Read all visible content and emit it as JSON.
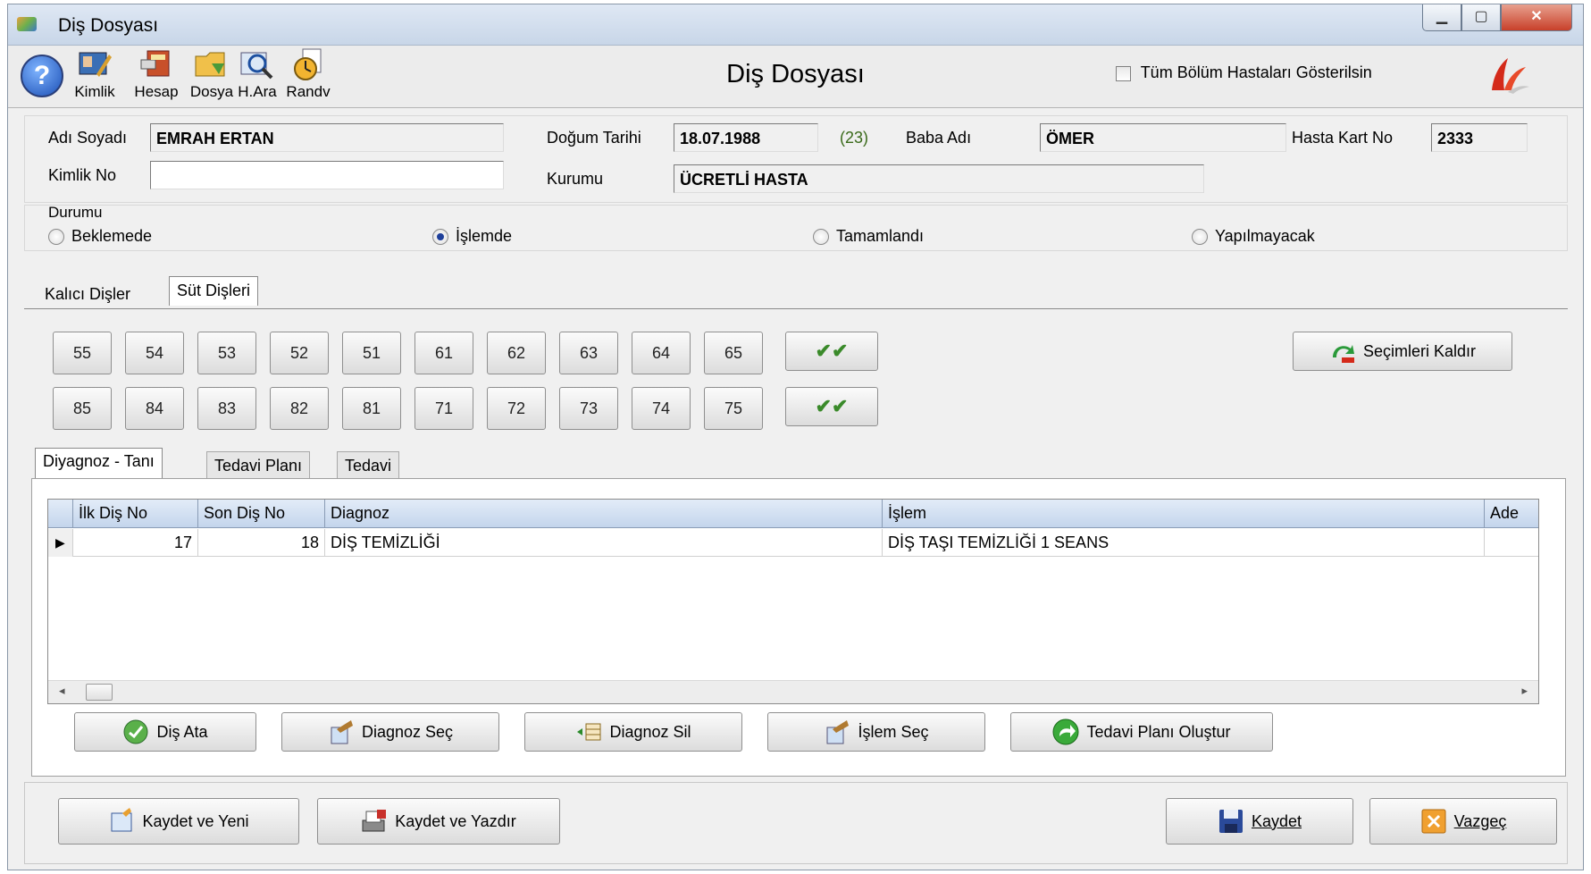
{
  "window": {
    "title": "Diş Dosyası"
  },
  "toolbar": {
    "items": [
      {
        "label": "Kimlik",
        "icon": "id-card-icon"
      },
      {
        "label": "Hesap",
        "icon": "calculator-icon"
      },
      {
        "label": "Dosya",
        "icon": "folder-icon"
      },
      {
        "label": "H.Ara",
        "icon": "search-icon"
      },
      {
        "label": "Randv",
        "icon": "clock-icon"
      }
    ],
    "form_title": "Diş Dosyası",
    "show_all_label": "Tüm Bölüm Hastaları Gösterilsin",
    "show_all_checked": false
  },
  "patient": {
    "name_label": "Adı Soyadı",
    "name_value": "EMRAH ERTAN",
    "dob_label": "Doğum Tarihi",
    "dob_value": "18.07.1988",
    "age": "(23)",
    "father_label": "Baba Adı",
    "father_value": "ÖMER",
    "card_label": "Hasta Kart No",
    "card_value": "2333",
    "id_label": "Kimlik No",
    "id_value": "",
    "institution_label": "Kurumu",
    "institution_value": "ÜCRETLİ HASTA"
  },
  "status": {
    "label": "Durumu",
    "options": [
      "Beklemede",
      "İşlemde",
      "Tamamlandı",
      "Yapılmayacak"
    ],
    "selected": "İşlemde"
  },
  "teeth_tabs": {
    "items": [
      "Kalıcı Dişler",
      "Süt Dişleri"
    ],
    "active": "Süt Dişleri"
  },
  "teeth": {
    "upper": [
      "55",
      "54",
      "53",
      "52",
      "51",
      "61",
      "62",
      "63",
      "64",
      "65"
    ],
    "lower": [
      "85",
      "84",
      "83",
      "82",
      "81",
      "71",
      "72",
      "73",
      "74",
      "75"
    ],
    "clear_label": "Seçimleri Kaldır"
  },
  "detail_tabs": {
    "items": [
      "Diyagnoz - Tanı",
      "Tedavi Planı",
      "Tedavi"
    ],
    "active": "Diyagnoz - Tanı"
  },
  "grid": {
    "columns": [
      "İlk Diş No",
      "Son Diş No",
      "Diagnoz",
      "İşlem",
      "Ade"
    ],
    "rows": [
      {
        "first": "17",
        "last": "18",
        "diagnosis": "DİŞ TEMİZLİĞİ",
        "procedure": "DİŞ TAŞI TEMİZLİĞİ 1 SEANS",
        "qty": ""
      }
    ]
  },
  "actions": {
    "assign": "Diş Ata",
    "select_diag": "Diagnoz Seç",
    "delete_diag": "Diagnoz Sil",
    "select_proc": "İşlem Seç",
    "create_plan": "Tedavi Planı Oluştur"
  },
  "footer": {
    "save_new": "Kaydet ve Yeni",
    "save_print": "Kaydet ve Yazdır",
    "save": "Kaydet",
    "cancel": "Vazgeç"
  }
}
